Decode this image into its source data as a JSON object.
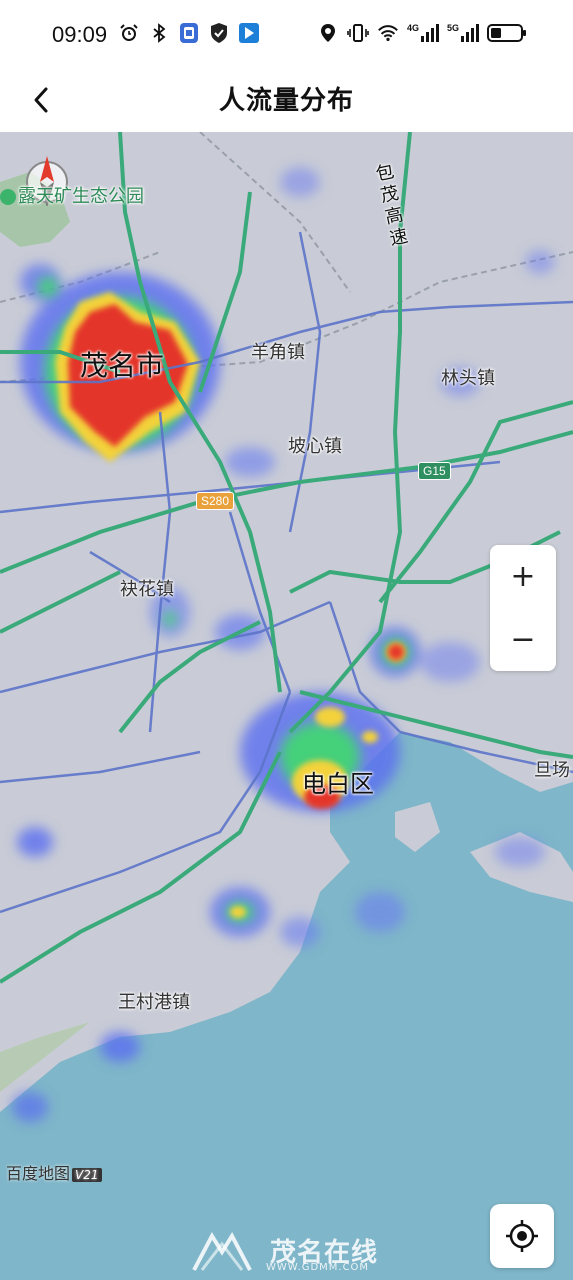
{
  "status_bar": {
    "time": "09:09",
    "icons_left": [
      "alarm-icon",
      "bluetooth-icon",
      "app-notification-icon",
      "shield-notification-icon",
      "app-notification-icon-2"
    ],
    "icons_right": [
      "location-icon",
      "vibrate-icon",
      "wifi-icon",
      "signal-4g-icon",
      "signal-5g-icon",
      "battery-icon"
    ],
    "net1": "4G",
    "net2": "5G"
  },
  "nav": {
    "back_icon": "chevron-left-icon",
    "title": "人流量分布"
  },
  "map": {
    "place_labels": {
      "park": "露天矿生态公园",
      "expressway": "包茂高速",
      "maoming": "茂名市",
      "yangjiao": "羊角镇",
      "lintou": "林头镇",
      "poxin": "坡心镇",
      "fuhua": "袂花镇",
      "dianbai": "电白区",
      "danchang": "旦场",
      "wangcungang": "王村港镇"
    },
    "road_shields": {
      "g15": "G15",
      "s280": "S280"
    },
    "attribution": "百度地图",
    "attribution_version": "V21",
    "zoom_in_label": "+",
    "zoom_out_label": "−",
    "colors": {
      "land": "#c9ccd6",
      "water": "#7fb6c9",
      "highway": "#3aaa7a",
      "road": "#5c74c9",
      "heat_hot": "#e8342b",
      "heat_warm": "#f5d23a",
      "heat_mid": "#4fd07a",
      "heat_cool": "#4f6df0"
    }
  },
  "watermark": {
    "main": "茂名在线",
    "sub": "WWW.GDMM.COM"
  }
}
